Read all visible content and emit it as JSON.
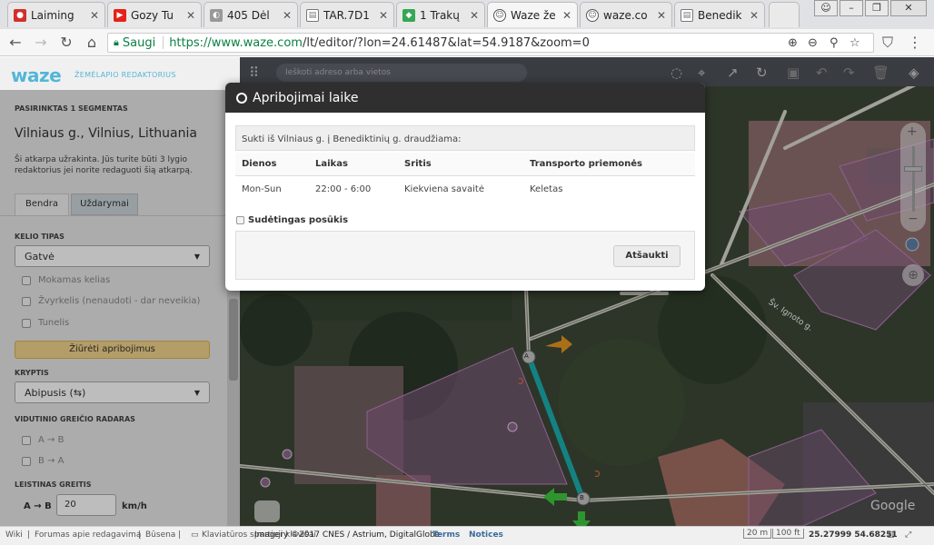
{
  "browser": {
    "tabs": [
      {
        "title": "Laiming",
        "icon": "laiming-icon",
        "color": "#d32f2f"
      },
      {
        "title": "Gozy Tu",
        "icon": "youtube-icon",
        "color": "#e62117"
      },
      {
        "title": "405 Dėl",
        "icon": "page-icon",
        "color": "#777777"
      },
      {
        "title": "TAR.7D1",
        "icon": "document-icon",
        "color": "#777777"
      },
      {
        "title": "1 Trakų",
        "icon": "google-maps-icon",
        "color": "#34a853"
      },
      {
        "title": "Waze že",
        "icon": "waze-icon",
        "color": "#555555"
      },
      {
        "title": "waze.co",
        "icon": "waze-icon",
        "color": "#555555"
      },
      {
        "title": "Benedik",
        "icon": "document-icon",
        "color": "#777777"
      }
    ],
    "secure_label": "Saugi",
    "url_host": "https://www.waze.com",
    "url_path": "/lt/editor/?lon=24.61487&lat=54.9187&zoom=0"
  },
  "app": {
    "logo": "waze",
    "subtitle": "ŽEMĖLAPIO REDAKTORIUS",
    "search_placeholder": "Ieškoti adreso arba vietos"
  },
  "sidebar": {
    "selected_label": "PASIRINKTAS 1 SEGMENTAS",
    "segment_name": "Vilniaus g., Vilnius, Lithuania",
    "lock_notice": "Ši atkarpa užrakinta. Jūs turite būti 3 lygio redaktorius jei norite redaguoti šią atkarpą.",
    "tabs": [
      "Bendra",
      "Uždarymai"
    ],
    "road_type_label": "KELIO TIPAS",
    "road_type_value": "Gatvė",
    "checkboxes": [
      "Mokamas kelias",
      "Žvyrkelis (nenaudoti - dar neveikia)",
      "Tunelis"
    ],
    "view_restrictions_button": "Žiūrėti apribojimus",
    "direction_label": "KRYPTIS",
    "direction_value": "Abipusis (⇆)",
    "speed_camera_label": "VIDUTINIO GREIČIO RADARAS",
    "speed_camera_options": [
      "A → B",
      "B → A"
    ],
    "speed_limit_label": "LEISTINAS GREITIS",
    "speed_ab_label": "A → B",
    "speed_ab_value": "20",
    "speed_unit": "km/h"
  },
  "modal": {
    "title": "Apribojimai laike",
    "description": "Sukti iš Vilniaus g. į Benediktinių g. draudžiama:",
    "columns": [
      "Dienos",
      "Laikas",
      "Sritis",
      "Transporto priemonės"
    ],
    "rows": [
      [
        "Mon-Sun",
        "22:00 - 6:00",
        "Kiekviena savaitė",
        "Keletas"
      ]
    ],
    "complex_turn_label": "Sudėtingas posūkis",
    "cancel_button": "Atšaukti"
  },
  "map": {
    "street_labels": [
      "Šv. Ignoto g."
    ],
    "node_a": "A",
    "node_b": "B",
    "google_watermark": "Google"
  },
  "statusbar": {
    "links": [
      "Wiki",
      "Forumas apie redagavimą",
      "Būsena",
      "Klaviatūros spartieji klavišai"
    ],
    "imagery": "Imagery ©2017 CNES / Astrium, DigitalGlobe",
    "terms": "Terms",
    "notices": "Notices",
    "scale_m": "20 m",
    "scale_ft": "100 ft",
    "coords": "25.27999 54.68251"
  }
}
